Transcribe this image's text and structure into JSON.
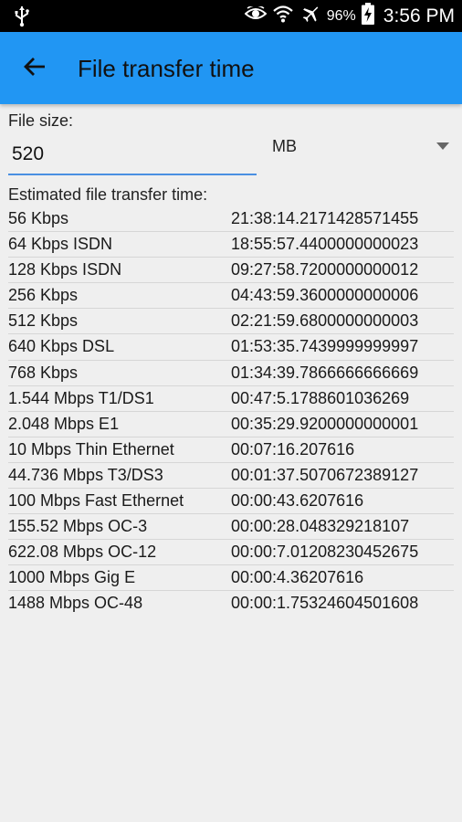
{
  "status_bar": {
    "usb_icon": "usb-icon",
    "eye_icon": "eye-icon",
    "wifi_icon": "wifi-icon",
    "airplane_icon": "airplane-icon",
    "battery_percent": "96%",
    "battery_icon": "battery-charging-icon",
    "time": "3:56 PM"
  },
  "toolbar": {
    "back_icon": "arrow-left-icon",
    "title": "File transfer time",
    "background_color": "#2196f3"
  },
  "form": {
    "file_size_label": "File size:",
    "file_size_value": "520",
    "unit_value": "MB",
    "dropdown_icon": "triangle-down-icon",
    "accent_color": "#4a90e2"
  },
  "results": {
    "heading": "Estimated file transfer time:",
    "rows": [
      {
        "speed": "56 Kbps",
        "time": "21:38:14.2171428571455"
      },
      {
        "speed": "64 Kbps ISDN",
        "time": "18:55:57.4400000000023"
      },
      {
        "speed": "128 Kbps ISDN",
        "time": "09:27:58.7200000000012"
      },
      {
        "speed": "256 Kbps",
        "time": "04:43:59.3600000000006"
      },
      {
        "speed": "512 Kbps",
        "time": "02:21:59.6800000000003"
      },
      {
        "speed": "640 Kbps DSL",
        "time": "01:53:35.7439999999997"
      },
      {
        "speed": "768 Kbps",
        "time": "01:34:39.7866666666669"
      },
      {
        "speed": "1.544 Mbps T1/DS1",
        "time": "00:47:5.1788601036269"
      },
      {
        "speed": "2.048 Mbps E1",
        "time": "00:35:29.9200000000001"
      },
      {
        "speed": "10 Mbps Thin Ethernet",
        "time": "00:07:16.207616"
      },
      {
        "speed": "44.736 Mbps T3/DS3",
        "time": "00:01:37.5070672389127"
      },
      {
        "speed": "100 Mbps Fast Ethernet",
        "time": "00:00:43.6207616"
      },
      {
        "speed": "155.52 Mbps OC-3",
        "time": "00:00:28.048329218107"
      },
      {
        "speed": "622.08 Mbps OC-12",
        "time": "00:00:7.01208230452675"
      },
      {
        "speed": "1000 Mbps Gig E",
        "time": "00:00:4.36207616"
      },
      {
        "speed": "1488 Mbps OC-48",
        "time": "00:00:1.75324604501608"
      }
    ]
  }
}
